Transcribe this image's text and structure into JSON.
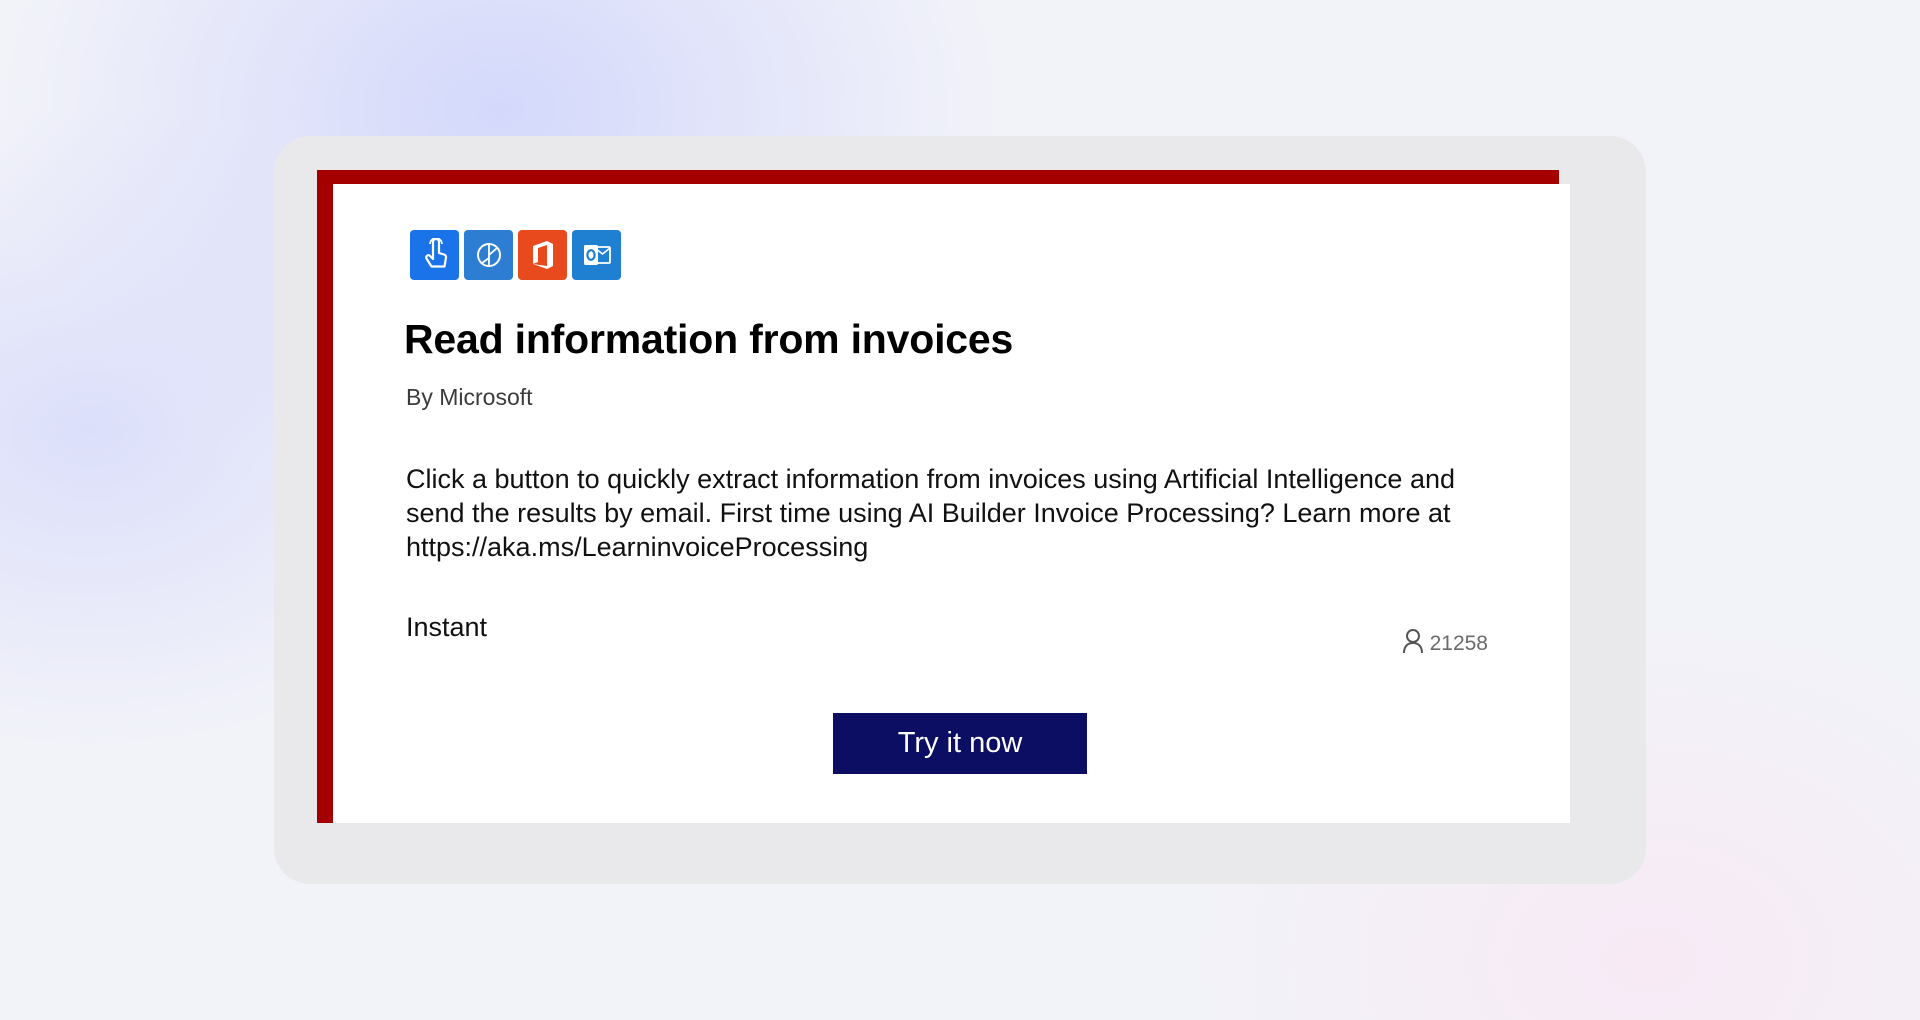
{
  "template": {
    "title": "Read information from invoices",
    "author": "By Microsoft",
    "description": "Click a button to quickly extract information from invoices using Artificial Intelligence and send the results by email. First time using AI Builder Invoice Processing? Learn more at https://aka.ms/LearninvoiceProcessing",
    "flow_type": "Instant",
    "user_count": "21258",
    "cta_label": "Try it now"
  },
  "connectors": [
    {
      "icon": "button-trigger-icon",
      "color": "#1a73e8"
    },
    {
      "icon": "ai-builder-icon",
      "color": "#2d7dd2"
    },
    {
      "icon": "office-365-icon",
      "color": "#e8491d"
    },
    {
      "icon": "outlook-icon",
      "color": "#1f7fd1"
    }
  ],
  "colors": {
    "accent_border": "#a40000",
    "button_bg": "#0c0e63",
    "button_text": "#ffffff"
  }
}
